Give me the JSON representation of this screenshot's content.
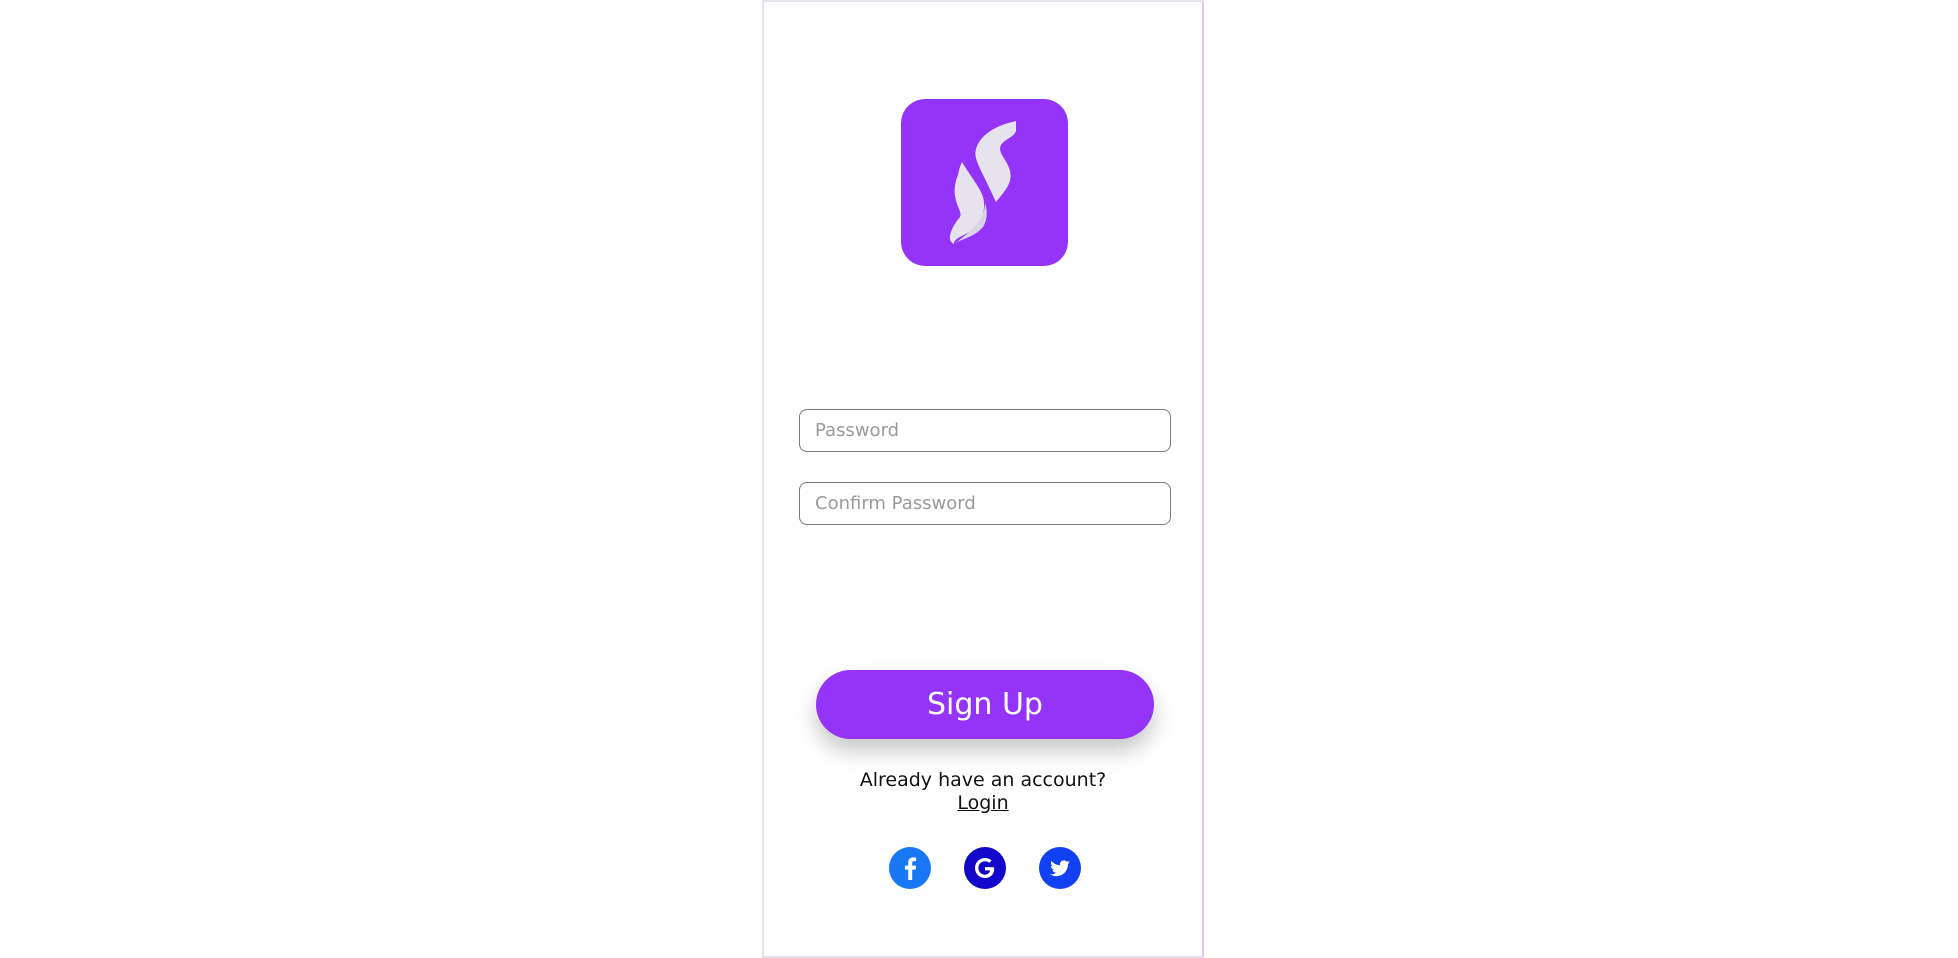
{
  "form": {
    "password_placeholder": "Password",
    "confirm_password_placeholder": "Confirm Password",
    "signup_label": "Sign Up"
  },
  "footer": {
    "account_prompt": "Already have an account?",
    "login_label": "Login"
  },
  "social": [
    {
      "name": "facebook",
      "icon": "facebook-icon",
      "color": "#1877f2"
    },
    {
      "name": "google",
      "icon": "google-icon",
      "color": "#1307c9"
    },
    {
      "name": "twitter",
      "icon": "twitter-icon",
      "color": "#1141f2"
    }
  ],
  "colors": {
    "brand": "#9534f9",
    "logo_mark": "#e6e3ee"
  },
  "logo": {
    "icon": "brand-s-logo"
  }
}
